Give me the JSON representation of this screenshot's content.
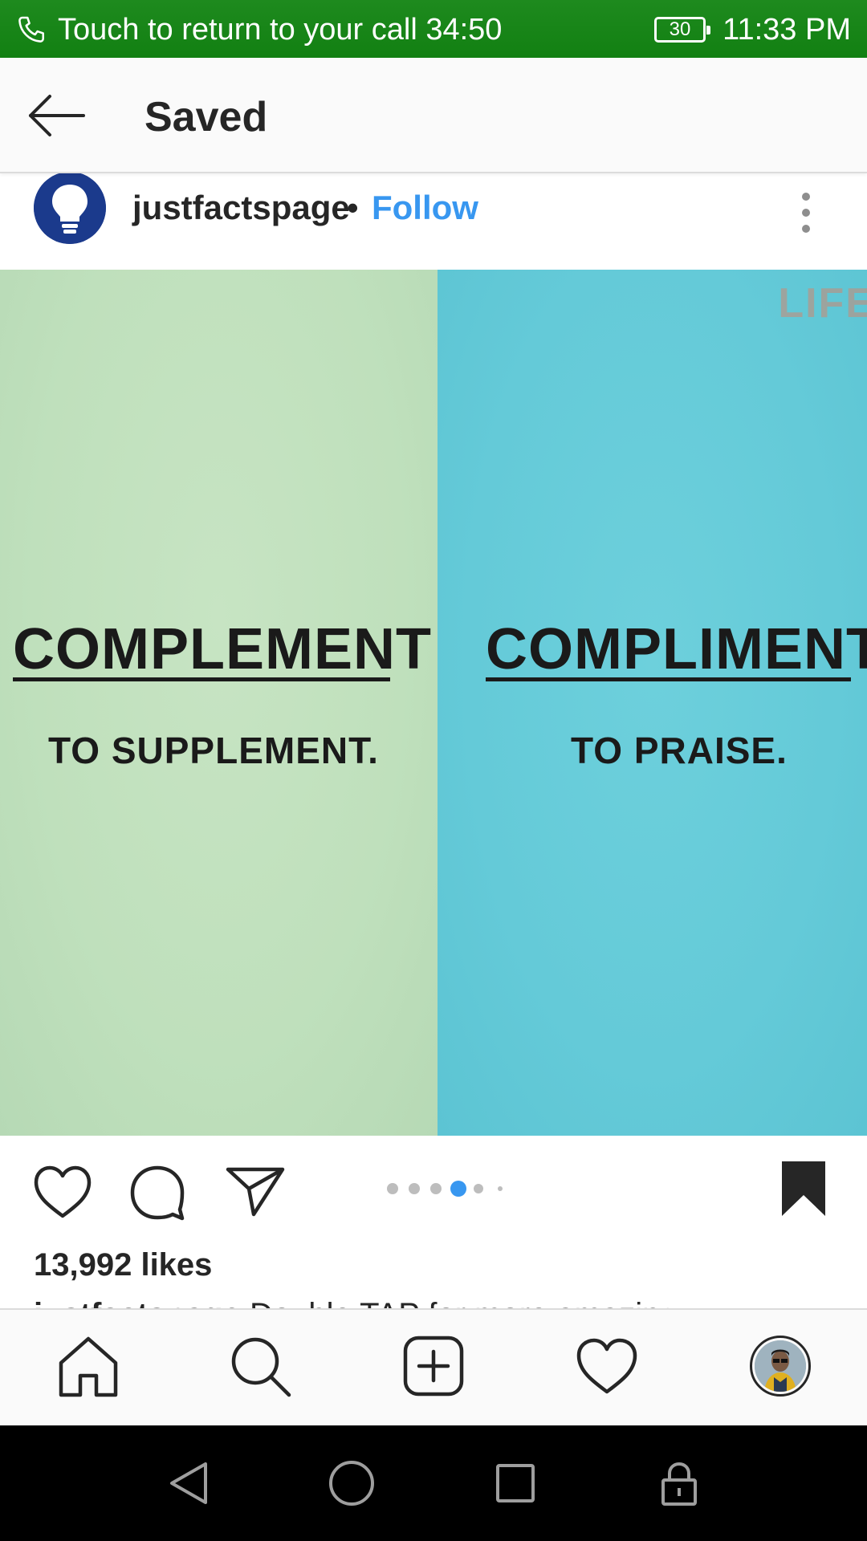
{
  "status_bar": {
    "call_text": "Touch to return to your call",
    "call_timer": "34:50",
    "battery_level": "30",
    "time": "11:33 PM",
    "background_color": "#138213"
  },
  "header": {
    "title": "Saved",
    "back_icon": "arrow-left-icon"
  },
  "post": {
    "username": "justfactspage",
    "separator": "•",
    "follow_label": "Follow",
    "more_icon": "more-vertical-icon",
    "image": {
      "left_word": "COMPLEMENT",
      "left_definition": "TO SUPPLEMENT.",
      "right_word": "COMPLIMENT",
      "right_definition": "TO PRAISE.",
      "watermark": "LIFE",
      "left_color": "#c2e2bf",
      "right_color": "#66cbd8"
    },
    "carousel": {
      "total_dots": 6,
      "active_index": 3,
      "active_color": "#3897f0"
    },
    "likes": "13,992 likes",
    "caption_username": "justfactspage",
    "caption_text": "Double TAP for more amazing"
  },
  "bottom_nav": {
    "items": [
      "home-icon",
      "search-icon",
      "add-post-icon",
      "activity-heart-icon",
      "profile-avatar"
    ]
  },
  "system_nav": {
    "items": [
      "back-triangle-icon",
      "home-circle-icon",
      "recents-square-icon",
      "lock-icon"
    ]
  }
}
